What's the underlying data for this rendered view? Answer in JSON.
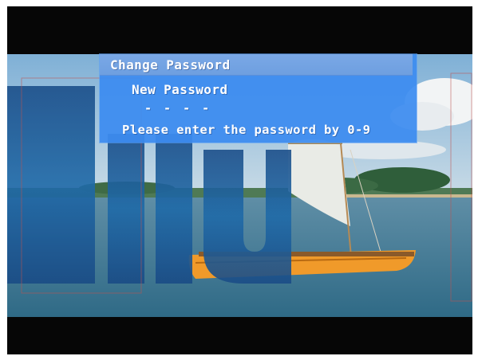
{
  "dialog": {
    "title": "Change Password",
    "field_label": "New Password",
    "password_mask": "- - - -",
    "hint": "Please enter the password by 0-9"
  },
  "colors": {
    "osd_panel": "#3c8cf0",
    "osd_header": "#7aa8e6",
    "text": "#ffffff",
    "letterbox": "#060606"
  }
}
